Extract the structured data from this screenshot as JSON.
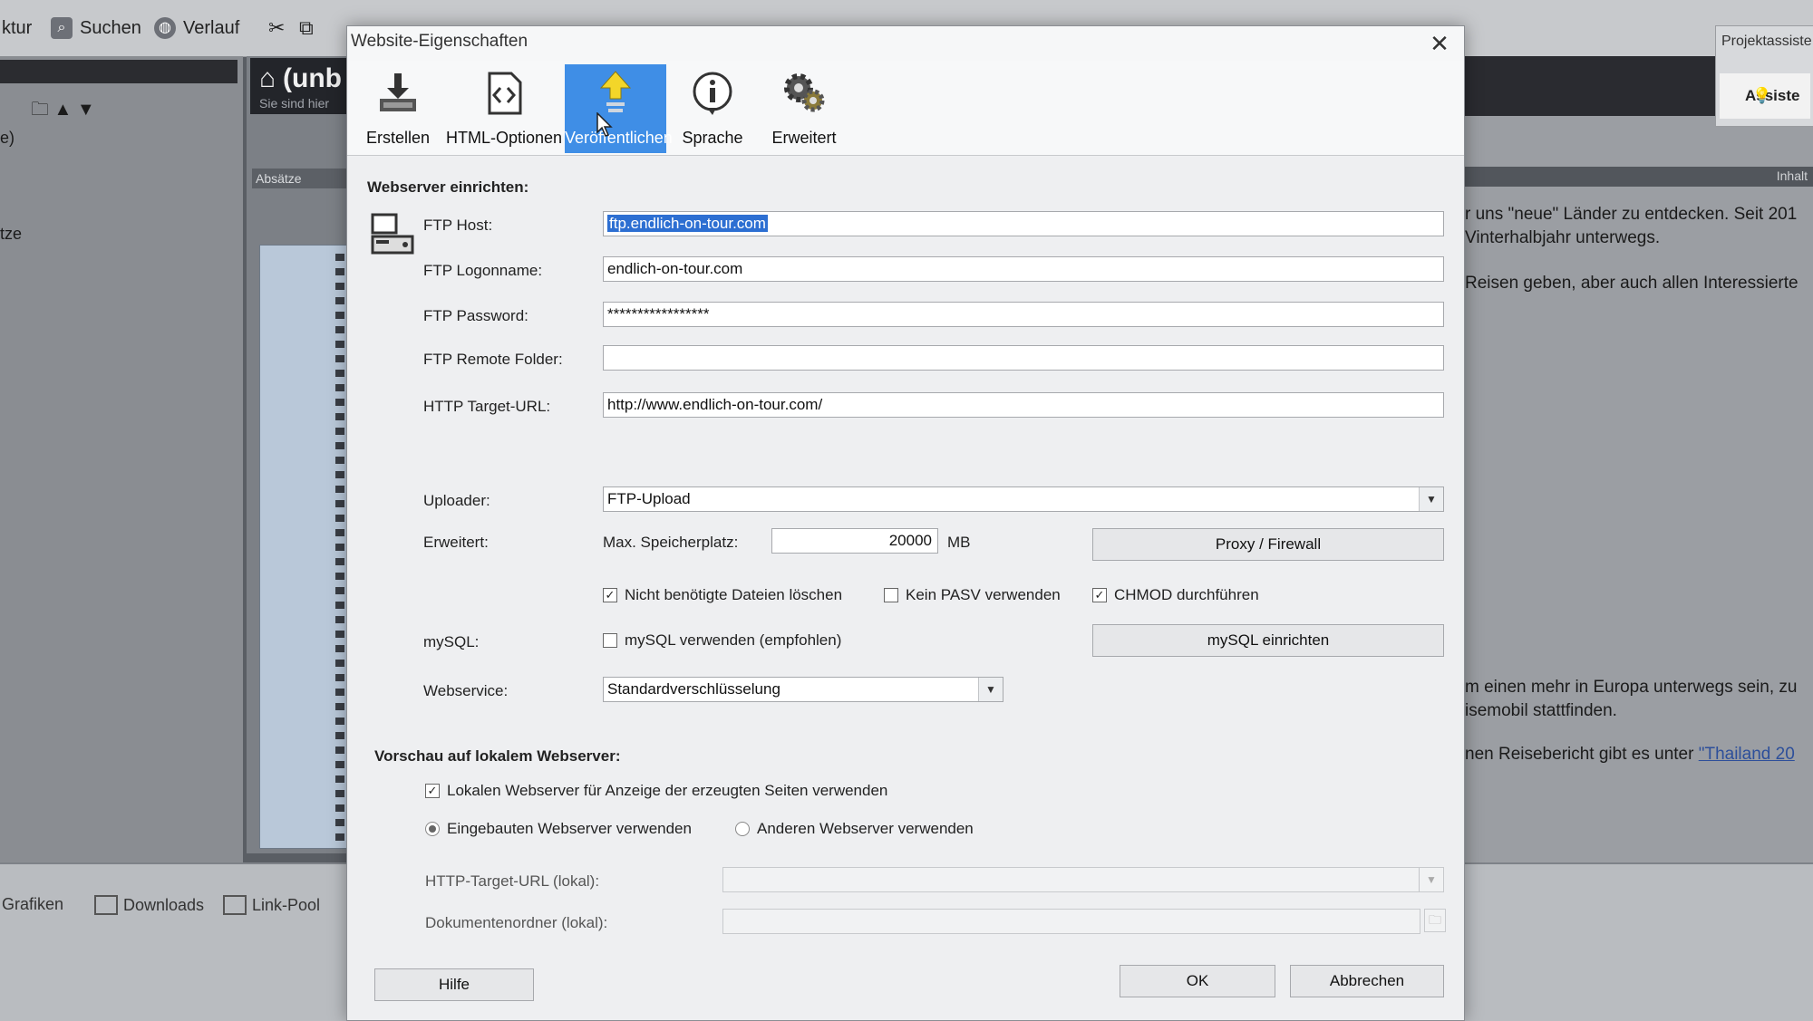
{
  "app": {
    "toolbar": [
      {
        "name": "struktur",
        "label": "ktur",
        "icon": "structure-icon"
      },
      {
        "name": "suchen",
        "label": "Suchen",
        "icon": "search-icon"
      },
      {
        "name": "verlauf",
        "label": "Verlauf",
        "icon": "globe-icon"
      }
    ],
    "left_panel_labels": [
      "e)",
      "tze"
    ],
    "tab_partial": "(unb",
    "tab_sub": "Sie sind hier",
    "absatze_label": "Absätze",
    "right_panel": {
      "assistant_header": "Projektassiste",
      "assistant_button": "Assiste",
      "strip_label": "Inhalt",
      "lines": [
        "r uns \"neue\" Länder zu entdecken. Seit 201",
        "Vinterhalbjahr unterwegs.",
        "Reisen geben, aber auch allen Interessierte",
        "m einen mehr in Europa unterwegs sein, zu",
        "isemobil stattfinden.",
        "nen Reisebericht gibt es unter"
      ],
      "link": "\"Thailand 20"
    },
    "bottom_items": [
      "Grafiken",
      "Downloads",
      "Link-Pool"
    ]
  },
  "dialog": {
    "title": "Website-Eigenschaften",
    "tabs": [
      {
        "label": "Erstellen",
        "icon": "download-icon"
      },
      {
        "label": "HTML-Optionen",
        "icon": "code-icon"
      },
      {
        "label": "Veröffentlichen",
        "icon": "upload-icon",
        "active": true
      },
      {
        "label": "Sprache",
        "icon": "info-icon"
      },
      {
        "label": "Erweitert",
        "icon": "gears-icon"
      }
    ],
    "webserver": {
      "heading": "Webserver einrichten:",
      "ftp_host_label": "FTP Host:",
      "ftp_host_value": "ftp.endlich-on-tour.com",
      "ftp_login_label": "FTP Logonname:",
      "ftp_login_value": "endlich-on-tour.com",
      "ftp_password_label": "FTP Password:",
      "ftp_password_value": "*****************",
      "ftp_remote_label": "FTP Remote Folder:",
      "ftp_remote_value": "",
      "http_target_label": "HTTP Target-URL:",
      "http_target_value": "http://www.endlich-on-tour.com/",
      "uploader_label": "Uploader:",
      "uploader_value": "FTP-Upload",
      "erweitert_label": "Erweitert:",
      "max_storage_label": "Max. Speicherplatz:",
      "max_storage_value": "20000",
      "max_storage_unit": "MB",
      "proxy_button": "Proxy / Firewall",
      "delete_unused": {
        "label": "Nicht benötigte Dateien löschen",
        "checked": true
      },
      "no_pasv": {
        "label": "Kein PASV verwenden",
        "checked": false
      },
      "chmod": {
        "label": "CHMOD durchführen",
        "checked": true
      },
      "mysql_label": "mySQL:",
      "mysql_use": {
        "label": "mySQL verwenden (empfohlen)",
        "checked": false
      },
      "mysql_button": "mySQL einrichten",
      "webservice_label": "Webservice:",
      "webservice_value": "Standardverschlüsselung"
    },
    "preview": {
      "heading": "Vorschau auf lokalem Webserver:",
      "use_local": {
        "label": "Lokalen Webserver für Anzeige der erzeugten Seiten verwenden",
        "checked": true
      },
      "builtin": {
        "label": "Eingebauten Webserver verwenden",
        "selected": true
      },
      "other": {
        "label": "Anderen Webserver verwenden",
        "selected": false
      },
      "http_local_label": "HTTP-Target-URL (lokal):",
      "http_local_value": "",
      "doc_folder_label": "Dokumentenordner (lokal):",
      "doc_folder_value": ""
    },
    "buttons": {
      "help": "Hilfe",
      "ok": "OK",
      "cancel": "Abbrechen"
    }
  }
}
